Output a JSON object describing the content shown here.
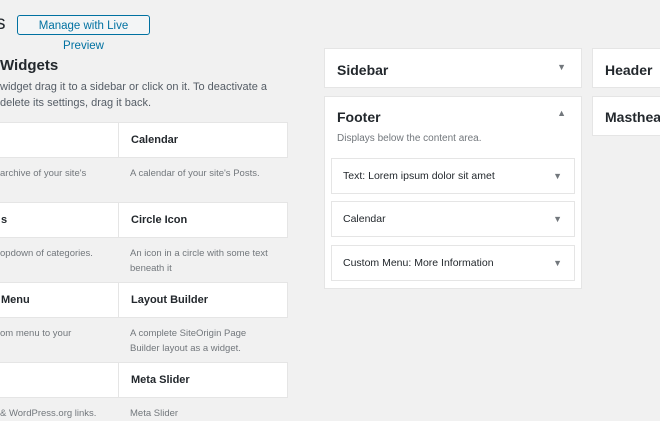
{
  "header": {
    "title_fragment": "s",
    "preview_button": "Manage with Live Preview"
  },
  "available": {
    "title": "Widgets",
    "description_lines": [
      " widget drag it to a sidebar or click on it. To deactivate a",
      "delete its settings, drag it back."
    ],
    "widgets": [
      {
        "name": "",
        "desc": [
          "archive of your site's"
        ]
      },
      {
        "name": "Calendar",
        "desc": [
          "A calendar of your site's Posts."
        ]
      },
      {
        "name": "s",
        "desc": [
          "opdown of categories."
        ]
      },
      {
        "name": "Circle Icon",
        "desc": [
          "An icon in a circle with some text",
          "beneath it"
        ]
      },
      {
        "name": "Menu",
        "desc": [
          "om menu to your"
        ]
      },
      {
        "name": "Layout Builder",
        "desc": [
          "A complete SiteOrigin Page",
          "Builder layout as a widget."
        ]
      },
      {
        "name": "",
        "desc": [
          " & WordPress.org links."
        ]
      },
      {
        "name": "Meta Slider",
        "desc": [
          "Meta Slider"
        ]
      }
    ]
  },
  "areas": {
    "sidebar": {
      "title": "Sidebar",
      "arrow": "▼"
    },
    "footer": {
      "title": "Footer",
      "arrow": "▲",
      "description": "Displays below the content area.",
      "widgets": [
        {
          "type": "Text",
          "title": ": Lorem ipsum dolor sit amet",
          "arrow": "▼"
        },
        {
          "type": "Calendar",
          "title": "",
          "arrow": "▼"
        },
        {
          "type": "Custom Menu",
          "title": ": More Information",
          "arrow": "▼"
        }
      ]
    },
    "header": {
      "title": "Header"
    },
    "masthead": {
      "title": "Masthead"
    }
  }
}
